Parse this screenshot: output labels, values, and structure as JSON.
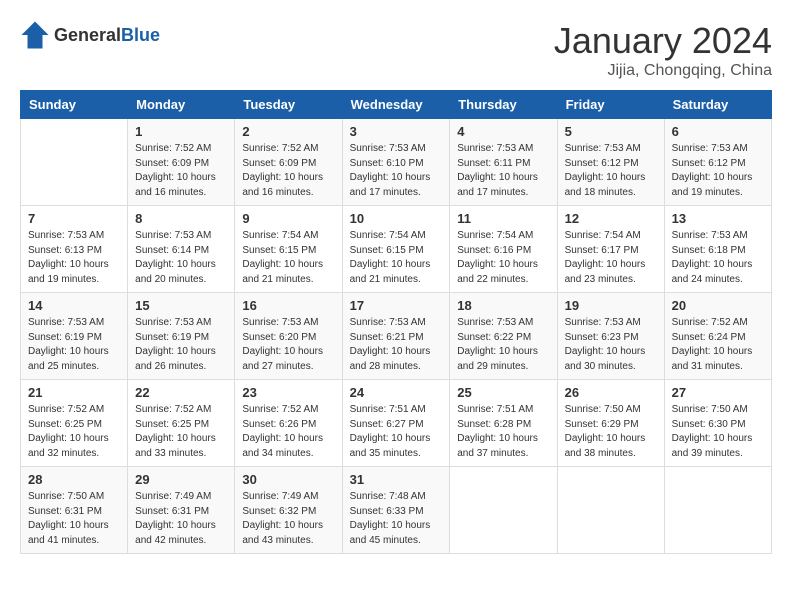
{
  "header": {
    "logo_general": "General",
    "logo_blue": "Blue",
    "month_year": "January 2024",
    "location": "Jijia, Chongqing, China"
  },
  "weekdays": [
    "Sunday",
    "Monday",
    "Tuesday",
    "Wednesday",
    "Thursday",
    "Friday",
    "Saturday"
  ],
  "weeks": [
    [
      {
        "day": "",
        "sunrise": "",
        "sunset": "",
        "daylight": ""
      },
      {
        "day": "1",
        "sunrise": "Sunrise: 7:52 AM",
        "sunset": "Sunset: 6:09 PM",
        "daylight": "Daylight: 10 hours and 16 minutes."
      },
      {
        "day": "2",
        "sunrise": "Sunrise: 7:52 AM",
        "sunset": "Sunset: 6:09 PM",
        "daylight": "Daylight: 10 hours and 16 minutes."
      },
      {
        "day": "3",
        "sunrise": "Sunrise: 7:53 AM",
        "sunset": "Sunset: 6:10 PM",
        "daylight": "Daylight: 10 hours and 17 minutes."
      },
      {
        "day": "4",
        "sunrise": "Sunrise: 7:53 AM",
        "sunset": "Sunset: 6:11 PM",
        "daylight": "Daylight: 10 hours and 17 minutes."
      },
      {
        "day": "5",
        "sunrise": "Sunrise: 7:53 AM",
        "sunset": "Sunset: 6:12 PM",
        "daylight": "Daylight: 10 hours and 18 minutes."
      },
      {
        "day": "6",
        "sunrise": "Sunrise: 7:53 AM",
        "sunset": "Sunset: 6:12 PM",
        "daylight": "Daylight: 10 hours and 19 minutes."
      }
    ],
    [
      {
        "day": "7",
        "sunrise": "Sunrise: 7:53 AM",
        "sunset": "Sunset: 6:13 PM",
        "daylight": "Daylight: 10 hours and 19 minutes."
      },
      {
        "day": "8",
        "sunrise": "Sunrise: 7:53 AM",
        "sunset": "Sunset: 6:14 PM",
        "daylight": "Daylight: 10 hours and 20 minutes."
      },
      {
        "day": "9",
        "sunrise": "Sunrise: 7:54 AM",
        "sunset": "Sunset: 6:15 PM",
        "daylight": "Daylight: 10 hours and 21 minutes."
      },
      {
        "day": "10",
        "sunrise": "Sunrise: 7:54 AM",
        "sunset": "Sunset: 6:15 PM",
        "daylight": "Daylight: 10 hours and 21 minutes."
      },
      {
        "day": "11",
        "sunrise": "Sunrise: 7:54 AM",
        "sunset": "Sunset: 6:16 PM",
        "daylight": "Daylight: 10 hours and 22 minutes."
      },
      {
        "day": "12",
        "sunrise": "Sunrise: 7:54 AM",
        "sunset": "Sunset: 6:17 PM",
        "daylight": "Daylight: 10 hours and 23 minutes."
      },
      {
        "day": "13",
        "sunrise": "Sunrise: 7:53 AM",
        "sunset": "Sunset: 6:18 PM",
        "daylight": "Daylight: 10 hours and 24 minutes."
      }
    ],
    [
      {
        "day": "14",
        "sunrise": "Sunrise: 7:53 AM",
        "sunset": "Sunset: 6:19 PM",
        "daylight": "Daylight: 10 hours and 25 minutes."
      },
      {
        "day": "15",
        "sunrise": "Sunrise: 7:53 AM",
        "sunset": "Sunset: 6:19 PM",
        "daylight": "Daylight: 10 hours and 26 minutes."
      },
      {
        "day": "16",
        "sunrise": "Sunrise: 7:53 AM",
        "sunset": "Sunset: 6:20 PM",
        "daylight": "Daylight: 10 hours and 27 minutes."
      },
      {
        "day": "17",
        "sunrise": "Sunrise: 7:53 AM",
        "sunset": "Sunset: 6:21 PM",
        "daylight": "Daylight: 10 hours and 28 minutes."
      },
      {
        "day": "18",
        "sunrise": "Sunrise: 7:53 AM",
        "sunset": "Sunset: 6:22 PM",
        "daylight": "Daylight: 10 hours and 29 minutes."
      },
      {
        "day": "19",
        "sunrise": "Sunrise: 7:53 AM",
        "sunset": "Sunset: 6:23 PM",
        "daylight": "Daylight: 10 hours and 30 minutes."
      },
      {
        "day": "20",
        "sunrise": "Sunrise: 7:52 AM",
        "sunset": "Sunset: 6:24 PM",
        "daylight": "Daylight: 10 hours and 31 minutes."
      }
    ],
    [
      {
        "day": "21",
        "sunrise": "Sunrise: 7:52 AM",
        "sunset": "Sunset: 6:25 PM",
        "daylight": "Daylight: 10 hours and 32 minutes."
      },
      {
        "day": "22",
        "sunrise": "Sunrise: 7:52 AM",
        "sunset": "Sunset: 6:25 PM",
        "daylight": "Daylight: 10 hours and 33 minutes."
      },
      {
        "day": "23",
        "sunrise": "Sunrise: 7:52 AM",
        "sunset": "Sunset: 6:26 PM",
        "daylight": "Daylight: 10 hours and 34 minutes."
      },
      {
        "day": "24",
        "sunrise": "Sunrise: 7:51 AM",
        "sunset": "Sunset: 6:27 PM",
        "daylight": "Daylight: 10 hours and 35 minutes."
      },
      {
        "day": "25",
        "sunrise": "Sunrise: 7:51 AM",
        "sunset": "Sunset: 6:28 PM",
        "daylight": "Daylight: 10 hours and 37 minutes."
      },
      {
        "day": "26",
        "sunrise": "Sunrise: 7:50 AM",
        "sunset": "Sunset: 6:29 PM",
        "daylight": "Daylight: 10 hours and 38 minutes."
      },
      {
        "day": "27",
        "sunrise": "Sunrise: 7:50 AM",
        "sunset": "Sunset: 6:30 PM",
        "daylight": "Daylight: 10 hours and 39 minutes."
      }
    ],
    [
      {
        "day": "28",
        "sunrise": "Sunrise: 7:50 AM",
        "sunset": "Sunset: 6:31 PM",
        "daylight": "Daylight: 10 hours and 41 minutes."
      },
      {
        "day": "29",
        "sunrise": "Sunrise: 7:49 AM",
        "sunset": "Sunset: 6:31 PM",
        "daylight": "Daylight: 10 hours and 42 minutes."
      },
      {
        "day": "30",
        "sunrise": "Sunrise: 7:49 AM",
        "sunset": "Sunset: 6:32 PM",
        "daylight": "Daylight: 10 hours and 43 minutes."
      },
      {
        "day": "31",
        "sunrise": "Sunrise: 7:48 AM",
        "sunset": "Sunset: 6:33 PM",
        "daylight": "Daylight: 10 hours and 45 minutes."
      },
      {
        "day": "",
        "sunrise": "",
        "sunset": "",
        "daylight": ""
      },
      {
        "day": "",
        "sunrise": "",
        "sunset": "",
        "daylight": ""
      },
      {
        "day": "",
        "sunrise": "",
        "sunset": "",
        "daylight": ""
      }
    ]
  ]
}
